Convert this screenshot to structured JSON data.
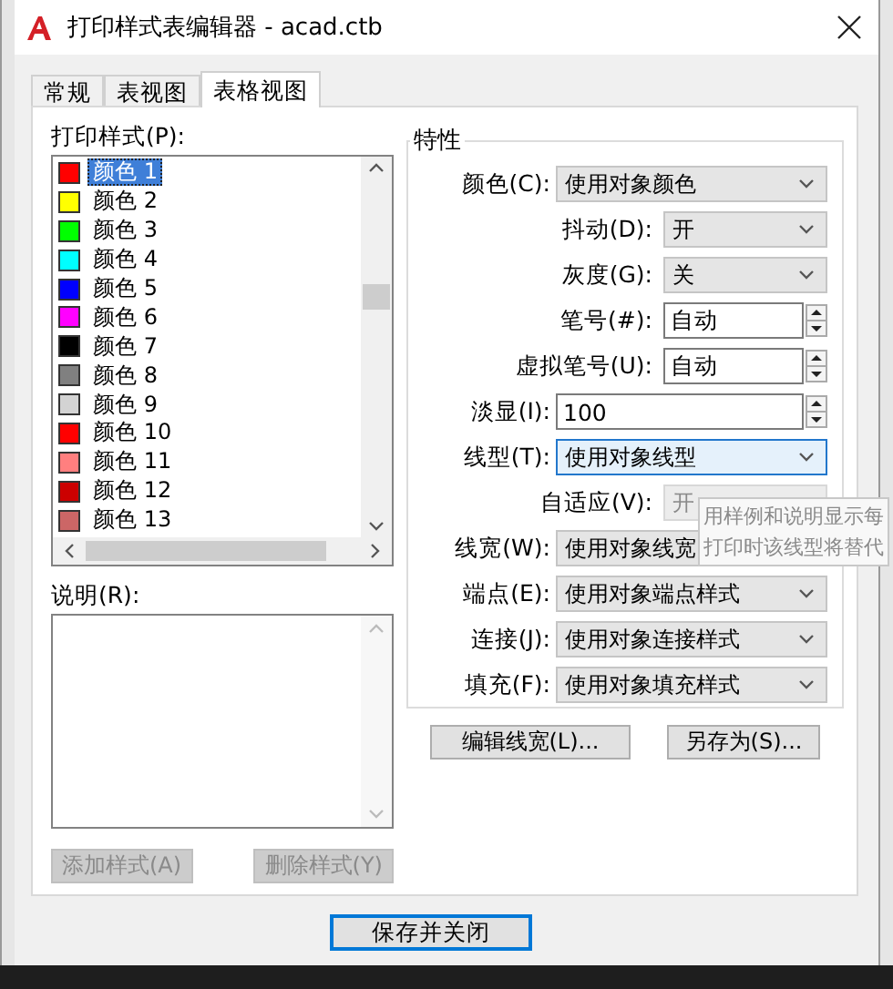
{
  "window": {
    "title": "打印样式表编辑器 - acad.ctb"
  },
  "tabs": [
    {
      "label": "常规",
      "selected": false
    },
    {
      "label": "表视图",
      "selected": false
    },
    {
      "label": "表格视图",
      "selected": true
    }
  ],
  "styles_list": {
    "label": "打印样式(P):",
    "items": [
      {
        "name": "颜色 1",
        "color": "#ff0000",
        "selected": true
      },
      {
        "name": "颜色 2",
        "color": "#ffff00",
        "selected": false
      },
      {
        "name": "颜色 3",
        "color": "#00ff00",
        "selected": false
      },
      {
        "name": "颜色 4",
        "color": "#00ffff",
        "selected": false
      },
      {
        "name": "颜色 5",
        "color": "#0000ff",
        "selected": false
      },
      {
        "name": "颜色 6",
        "color": "#ff00ff",
        "selected": false
      },
      {
        "name": "颜色 7",
        "color": "#000000",
        "selected": false
      },
      {
        "name": "颜色 8",
        "color": "#808080",
        "selected": false
      },
      {
        "name": "颜色 9",
        "color": "#d3d3d3",
        "selected": false
      },
      {
        "name": "颜色 10",
        "color": "#ff0000",
        "selected": false
      },
      {
        "name": "颜色 11",
        "color": "#ff7f7f",
        "selected": false
      },
      {
        "name": "颜色 12",
        "color": "#cc0000",
        "selected": false
      },
      {
        "name": "颜色 13",
        "color": "#cc6666",
        "selected": false
      }
    ]
  },
  "description": {
    "label": "说明(R):"
  },
  "list_buttons": [
    {
      "label": "添加样式(A)",
      "disabled": true
    },
    {
      "label": "删除样式(Y)",
      "disabled": true
    }
  ],
  "properties": {
    "title": "特性",
    "fields": [
      {
        "kind": "combo",
        "label": "颜色(C):",
        "value": "使用对象颜色",
        "compact": false,
        "disabled": false,
        "focused": false
      },
      {
        "kind": "combo",
        "label": "抖动(D):",
        "value": "开",
        "compact": true,
        "disabled": false,
        "focused": false
      },
      {
        "kind": "combo",
        "label": "灰度(G):",
        "value": "关",
        "compact": true,
        "disabled": false,
        "focused": false
      },
      {
        "kind": "spin",
        "label": "笔号(#):",
        "value": "自动",
        "compact": true
      },
      {
        "kind": "spin",
        "label": "虚拟笔号(U):",
        "value": "自动",
        "compact": true
      },
      {
        "kind": "spin",
        "label": "淡显(I):",
        "value": "100",
        "compact": false
      },
      {
        "kind": "combo",
        "label": "线型(T):",
        "value": "使用对象线型",
        "compact": false,
        "disabled": false,
        "focused": true
      },
      {
        "kind": "combo",
        "label": "自适应(V):",
        "value": "开",
        "compact": true,
        "disabled": true,
        "focused": false
      },
      {
        "kind": "combo",
        "label": "线宽(W):",
        "value": "使用对象线宽",
        "compact": false,
        "disabled": false,
        "focused": false
      },
      {
        "kind": "combo",
        "label": "端点(E):",
        "value": "使用对象端点样式",
        "compact": false,
        "disabled": false,
        "focused": false
      },
      {
        "kind": "combo",
        "label": "连接(J):",
        "value": "使用对象连接样式",
        "compact": false,
        "disabled": false,
        "focused": false
      },
      {
        "kind": "combo",
        "label": "填充(F):",
        "value": "使用对象填充样式",
        "compact": false,
        "disabled": false,
        "focused": false
      }
    ]
  },
  "property_buttons": [
    {
      "label": "编辑线宽(L)..."
    },
    {
      "label": "另存为(S)..."
    }
  ],
  "tooltip": {
    "lines": [
      "用样例和说明显示每",
      "打印时该线型将替代"
    ]
  },
  "footer_buttons": [
    {
      "label": "保存并关闭",
      "focused": true
    }
  ]
}
